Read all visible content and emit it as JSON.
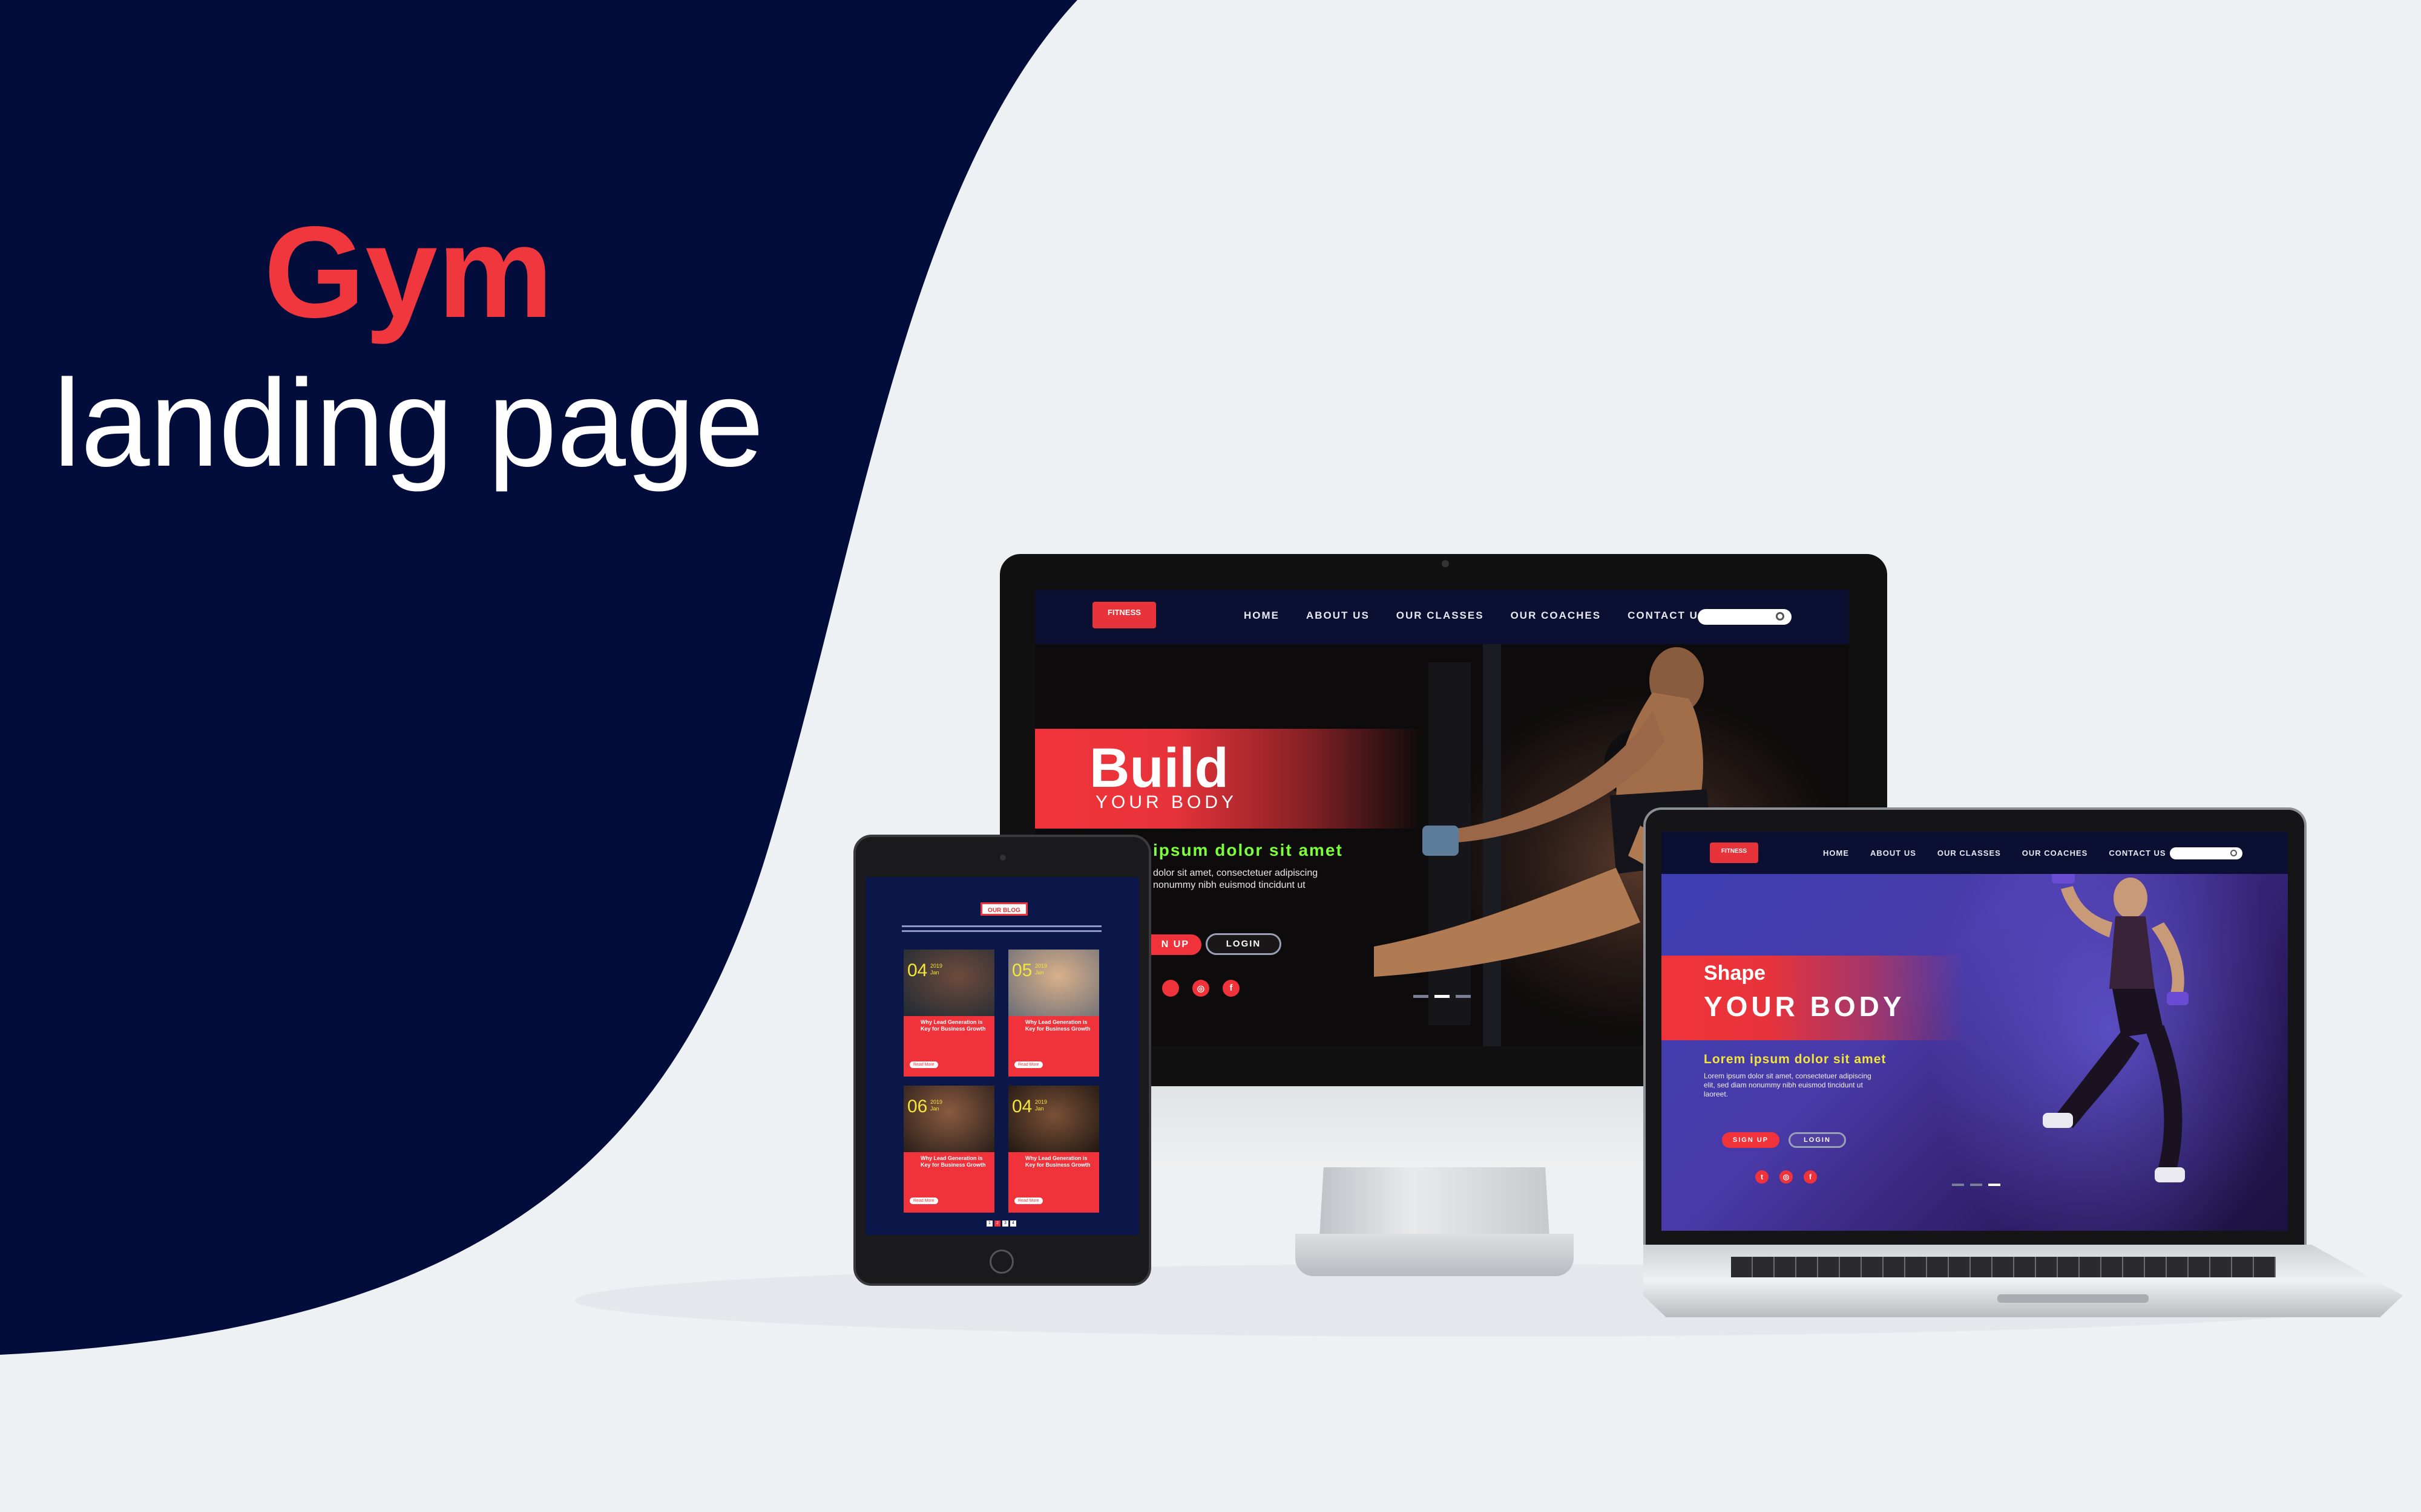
{
  "hero": {
    "title": "Gym",
    "subtitle": "landing page"
  },
  "colors": {
    "navy": "#030d3b",
    "accent": "#f0373d",
    "background": "#eef1f4",
    "green_text": "#7dff3a",
    "yellow_text": "#f2e53b"
  },
  "desktop": {
    "logo_text": "FITNESS",
    "nav": [
      "HOME",
      "ABOUT US",
      "OUR CLASSES",
      "OUR COACHES",
      "CONTACT US"
    ],
    "hero_title": "Build",
    "hero_sub": "YOUR BODY",
    "tagline": "ipsum dolor sit amet",
    "body_line1": "dolor sit amet, consectetuer adipiscing",
    "body_line2": "nonummy nibh euismod tincidunt ut",
    "signup": "N UP",
    "login": "LOGIN",
    "social_icons": [
      "instagram-icon",
      "instagram-icon",
      "facebook-icon"
    ]
  },
  "laptop": {
    "logo_text": "FITNESS",
    "nav": [
      "HOME",
      "ABOUT US",
      "OUR CLASSES",
      "OUR COACHES",
      "CONTACT US"
    ],
    "hero_title": "Shape",
    "hero_sub": "YOUR BODY",
    "tagline": "Lorem ipsum dolor sit amet",
    "body_line1": "Lorem ipsum dolor sit amet, consectetuer adipiscing",
    "body_line2": "elit, sed diam nonummy nibh euismod tincidunt ut",
    "body_line3": "laoreet.",
    "signup": "SIGN UP",
    "login": "LOGIN",
    "social_icons": [
      "twitter-icon",
      "instagram-icon",
      "facebook-icon"
    ]
  },
  "tablet": {
    "section_title": "OUR BLOG",
    "cards": [
      {
        "day": "04",
        "month": "2019 Jan",
        "title": "Why Lead Generation is Key for Business Growth",
        "button": "Read More"
      },
      {
        "day": "05",
        "month": "2019 Jan",
        "title": "Why Lead Generation is Key for Business Growth",
        "button": "Read More"
      },
      {
        "day": "06",
        "month": "2019 Jan",
        "title": "Why Lead Generation is Key for Business Growth",
        "button": "Read More"
      },
      {
        "day": "04",
        "month": "2019 Jan",
        "title": "Why Lead Generation is Key for Business Growth",
        "button": "Read More"
      }
    ],
    "pages": [
      "1",
      "2",
      "3",
      "4"
    ]
  }
}
